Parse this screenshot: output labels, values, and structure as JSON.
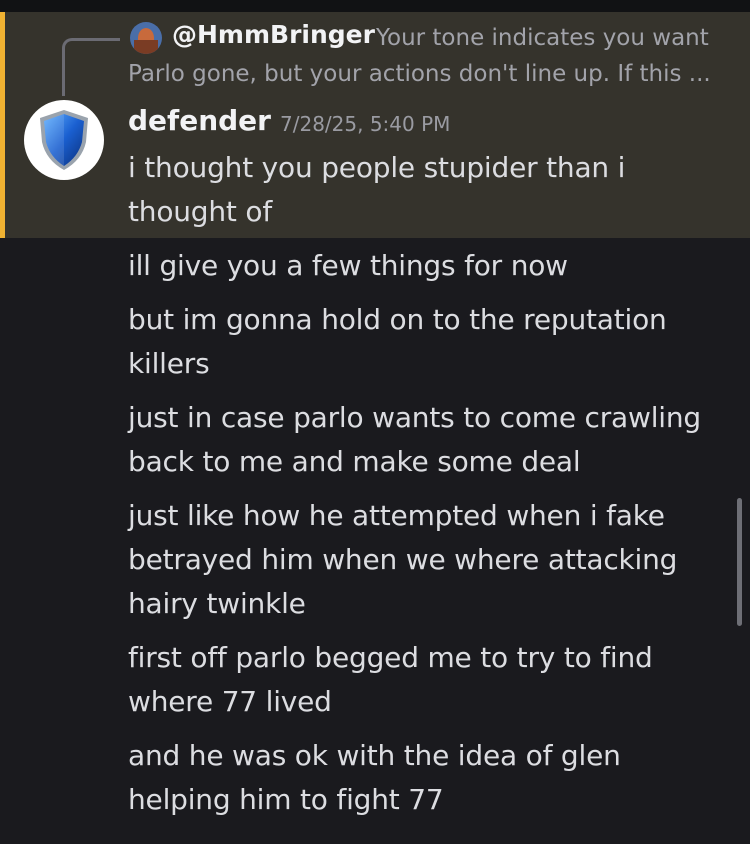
{
  "reply": {
    "username": "@HmmBringer",
    "preview": "Your tone indicates you want Parlo gone, but your actions don't line up. If this ..."
  },
  "message": {
    "username": "defender",
    "timestamp": "7/28/25, 5:40 PM",
    "avatar_icon": "shield-icon",
    "lines": [
      "i thought you people stupider than i thought of",
      "ill give you a few things for now",
      "but im gonna hold on to the reputation killers",
      "just in case parlo wants to come crawling back to me and make some deal",
      "just like how he attempted when i fake betrayed him when we where attacking hairy twinkle",
      "first off parlo begged me to try to find where 77 lived",
      "and he was ok with the idea of glen helping him to fight 77"
    ]
  },
  "colors": {
    "background": "#1a1a1e",
    "highlight": "#35332c",
    "highlight_bar": "#f0b232",
    "text": "#dcdde1",
    "muted": "#9a9ba2"
  }
}
